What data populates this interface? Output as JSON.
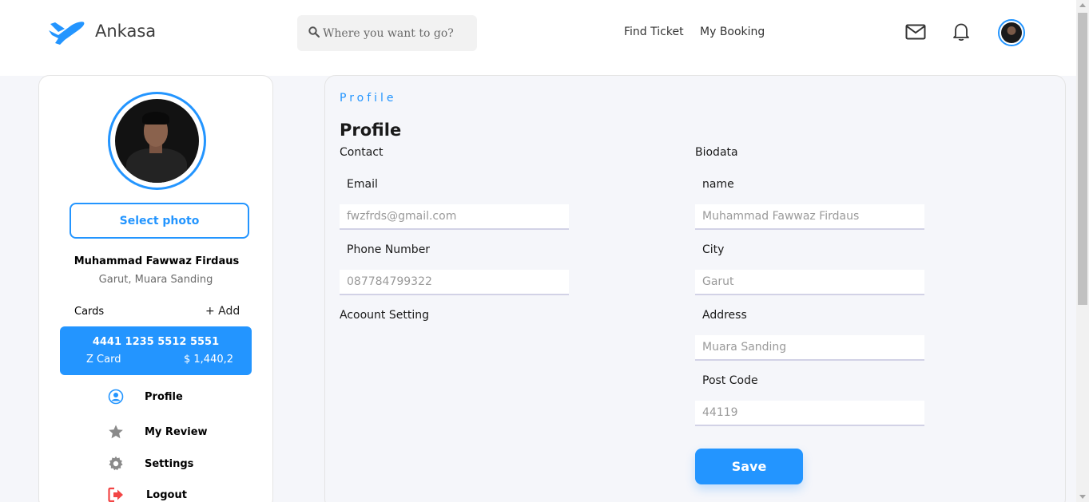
{
  "brand": {
    "name": "Ankasa",
    "accent": "#2395ff"
  },
  "search": {
    "placeholder": "Where you want to go?"
  },
  "nav": {
    "find_ticket": "Find Ticket",
    "my_booking": "My Booking"
  },
  "header_icons": [
    "mail-icon",
    "bell-icon"
  ],
  "sidebar": {
    "select_photo": "Select photo",
    "user_name": "Muhammad Fawwaz Firdaus",
    "user_location": "Garut, Muara Sanding",
    "cards_label": "Cards",
    "add_label": "+ Add",
    "card": {
      "number": "4441 1235 5512 5551",
      "name": "Z Card",
      "balance": "$ 1,440,2"
    },
    "menu": [
      {
        "label": "Profile",
        "icon": "user-circle-icon"
      },
      {
        "label": "My Review",
        "icon": "star-icon"
      },
      {
        "label": "Settings",
        "icon": "gear-icon"
      },
      {
        "label": "Logout",
        "icon": "logout-icon"
      }
    ]
  },
  "main": {
    "eyebrow": "Profile",
    "title": "Profile",
    "contact": {
      "heading": "Contact",
      "email_label": "Email",
      "email_placeholder": "fwzfrds@gmail.com",
      "phone_label": "Phone Number",
      "phone_placeholder": "087784799322"
    },
    "account_setting": "Acoount Setting",
    "biodata": {
      "heading": "Biodata",
      "name_label": "name",
      "name_placeholder": "Muhammad Fawwaz Firdaus",
      "city_label": "City",
      "city_placeholder": "Garut",
      "address_label": "Address",
      "address_placeholder": "Muara Sanding",
      "postcode_label": "Post Code",
      "postcode_placeholder": "44119"
    },
    "save_label": "Save"
  }
}
